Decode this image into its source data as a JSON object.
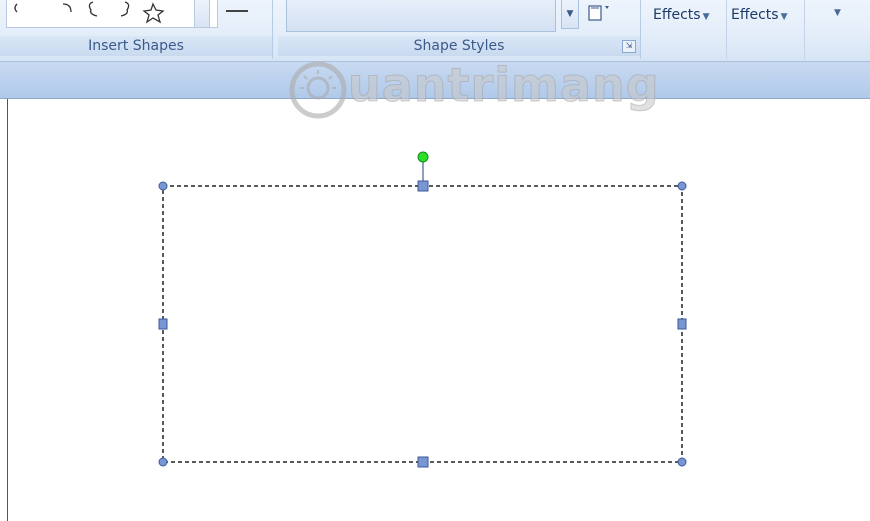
{
  "ribbon": {
    "insert_shapes": {
      "label": "Insert Shapes"
    },
    "shape_styles": {
      "label": "Shape Styles",
      "launcher_glyph": "⇲"
    },
    "effects_buttons": [
      {
        "label": "Effects",
        "caret": "▼"
      },
      {
        "label": "Effects",
        "caret": "▼"
      }
    ],
    "more_caret": "▼",
    "style_gallery_arrow": "▼"
  },
  "watermark": {
    "text": "uantrimang",
    "brand_color": "#c8c8c8"
  },
  "shape": {
    "state": "selected",
    "outline": "dashed",
    "handle_color": "#6f8fd0",
    "rotation_handle_color": "#22dd22"
  },
  "icons": {
    "gallery_shapes": [
      "curve-icon",
      "arc-icon",
      "brace-left-icon",
      "brace-right-icon",
      "star-icon"
    ]
  }
}
